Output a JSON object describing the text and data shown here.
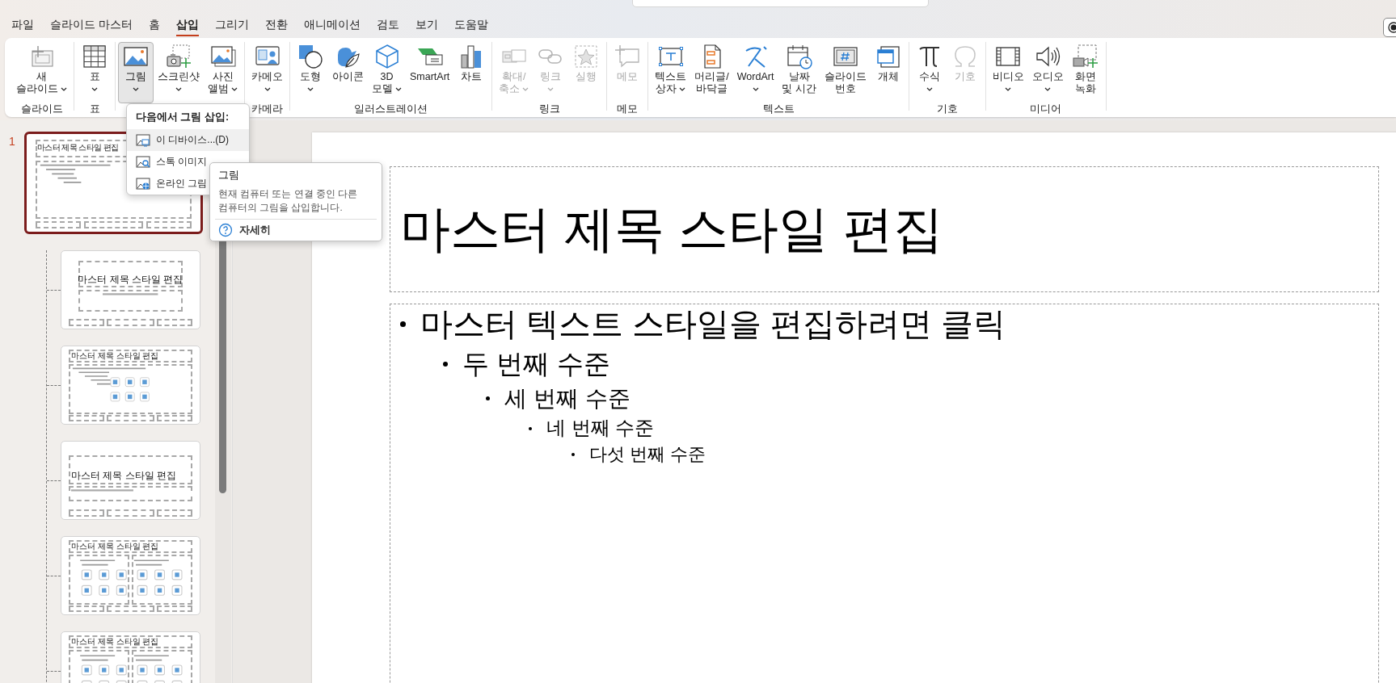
{
  "menu": {
    "tabs": [
      {
        "label": "파일",
        "selected": false
      },
      {
        "label": "슬라이드 마스터",
        "selected": false
      },
      {
        "label": "홈",
        "selected": false
      },
      {
        "label": "삽입",
        "selected": true
      },
      {
        "label": "그리기",
        "selected": false
      },
      {
        "label": "전환",
        "selected": false
      },
      {
        "label": "애니메이션",
        "selected": false
      },
      {
        "label": "검토",
        "selected": false
      },
      {
        "label": "보기",
        "selected": false
      },
      {
        "label": "도움말",
        "selected": false
      }
    ]
  },
  "ribbon": {
    "groups": [
      {
        "label": "슬라이드",
        "buttons": [
          {
            "lines": [
              "새",
              "슬라이드"
            ],
            "dropdown": true,
            "disabled": false,
            "open": false
          }
        ]
      },
      {
        "label": "표",
        "buttons": [
          {
            "lines": [
              "표"
            ],
            "dropdown": true,
            "disabled": false,
            "open": false
          }
        ]
      },
      {
        "buttons": [
          {
            "lines": [
              "그림"
            ],
            "dropdown": true,
            "disabled": false,
            "open": true
          },
          {
            "lines": [
              "스크린샷"
            ],
            "dropdown": true,
            "disabled": false,
            "open": false
          },
          {
            "lines": [
              "사진",
              "앨범"
            ],
            "dropdown": true,
            "disabled": false,
            "open": false
          }
        ]
      },
      {
        "label": "카메라",
        "buttons": [
          {
            "lines": [
              "카메오"
            ],
            "dropdown": true,
            "disabled": false,
            "open": false
          }
        ]
      },
      {
        "label": "일러스트레이션",
        "buttons": [
          {
            "lines": [
              "도형"
            ],
            "dropdown": true,
            "disabled": false,
            "open": false
          },
          {
            "lines": [
              "아이콘"
            ],
            "dropdown": false,
            "disabled": false,
            "open": false
          },
          {
            "lines": [
              "3D",
              "모델"
            ],
            "dropdown": true,
            "disabled": false,
            "open": false
          },
          {
            "lines": [
              "SmartArt"
            ],
            "dropdown": false,
            "disabled": false,
            "open": false
          },
          {
            "lines": [
              "차트"
            ],
            "dropdown": false,
            "disabled": false,
            "open": false
          }
        ]
      },
      {
        "label": "링크",
        "buttons": [
          {
            "lines": [
              "확대/",
              "축소"
            ],
            "dropdown": true,
            "disabled": true,
            "open": false
          },
          {
            "lines": [
              "링크"
            ],
            "dropdown": true,
            "disabled": true,
            "open": false
          },
          {
            "lines": [
              "실행"
            ],
            "dropdown": false,
            "disabled": true,
            "open": false
          }
        ]
      },
      {
        "label": "메모",
        "buttons": [
          {
            "lines": [
              "메모"
            ],
            "dropdown": false,
            "disabled": true,
            "open": false
          }
        ]
      },
      {
        "label": "텍스트",
        "buttons": [
          {
            "lines": [
              "텍스트",
              "상자"
            ],
            "dropdown": true,
            "disabled": false,
            "open": false
          },
          {
            "lines": [
              "머리글/",
              "바닥글"
            ],
            "dropdown": false,
            "disabled": false,
            "open": false
          },
          {
            "lines": [
              "WordArt"
            ],
            "dropdown": true,
            "disabled": false,
            "open": false
          },
          {
            "lines": [
              "날짜",
              "및 시간"
            ],
            "dropdown": false,
            "disabled": false,
            "open": false
          },
          {
            "lines": [
              "슬라이드",
              "번호"
            ],
            "dropdown": false,
            "disabled": false,
            "open": false
          },
          {
            "lines": [
              "개체"
            ],
            "dropdown": false,
            "disabled": false,
            "open": false
          }
        ]
      },
      {
        "label": "기호",
        "buttons": [
          {
            "lines": [
              "수식"
            ],
            "dropdown": true,
            "disabled": false,
            "open": false
          },
          {
            "lines": [
              "기호"
            ],
            "dropdown": false,
            "disabled": true,
            "open": false
          }
        ]
      },
      {
        "label": "미디어",
        "buttons": [
          {
            "lines": [
              "비디오"
            ],
            "dropdown": true,
            "disabled": false,
            "open": false
          },
          {
            "lines": [
              "오디오"
            ],
            "dropdown": true,
            "disabled": false,
            "open": false
          },
          {
            "lines": [
              "화면",
              "녹화"
            ],
            "dropdown": false,
            "disabled": false,
            "open": false
          }
        ]
      }
    ]
  },
  "picture_menu": {
    "header": "다음에서 그림 삽입:",
    "items": [
      {
        "label": "이 디바이스...(D)",
        "selected": true
      },
      {
        "label": "스톡 이미지",
        "selected": false
      },
      {
        "label": "온라인 그림",
        "selected": false
      }
    ]
  },
  "tooltip": {
    "title": "그림",
    "description": "현재 컴퓨터 또는 연결 중인 다른 컴퓨터의 그림을 삽입합니다.",
    "link": "자세히"
  },
  "slides": [
    {
      "number": "1",
      "kind": "master",
      "title": "마스터 제목 스타일 편집",
      "selected": true,
      "children": [
        {
          "kind": "title_slide",
          "title": "마스터 제목 스타일 편집",
          "selected": false
        },
        {
          "kind": "title_content",
          "title": "마스터 제목 스타일 편집",
          "selected": false
        },
        {
          "kind": "section_header",
          "title": "마스터 제목 스타일 편집",
          "selected": false
        },
        {
          "kind": "two_content",
          "title": "마스터 제목 스타일 편집",
          "selected": false
        },
        {
          "kind": "comparison",
          "title": "마스터 제목 스타일 편집",
          "selected": false
        }
      ]
    }
  ],
  "slide": {
    "title": "마스터 제목 스타일 편집",
    "body": [
      {
        "text": "마스터 텍스트 스타일을 편집하려면 클릭",
        "children": [
          {
            "text": "두 번째 수준",
            "children": [
              {
                "text": "세 번째 수준",
                "children": [
                  {
                    "text": "네 번째 수준",
                    "children": [
                      {
                        "text": "다섯 번째 수준"
                      }
                    ]
                  }
                ]
              }
            ]
          }
        ]
      }
    ]
  }
}
